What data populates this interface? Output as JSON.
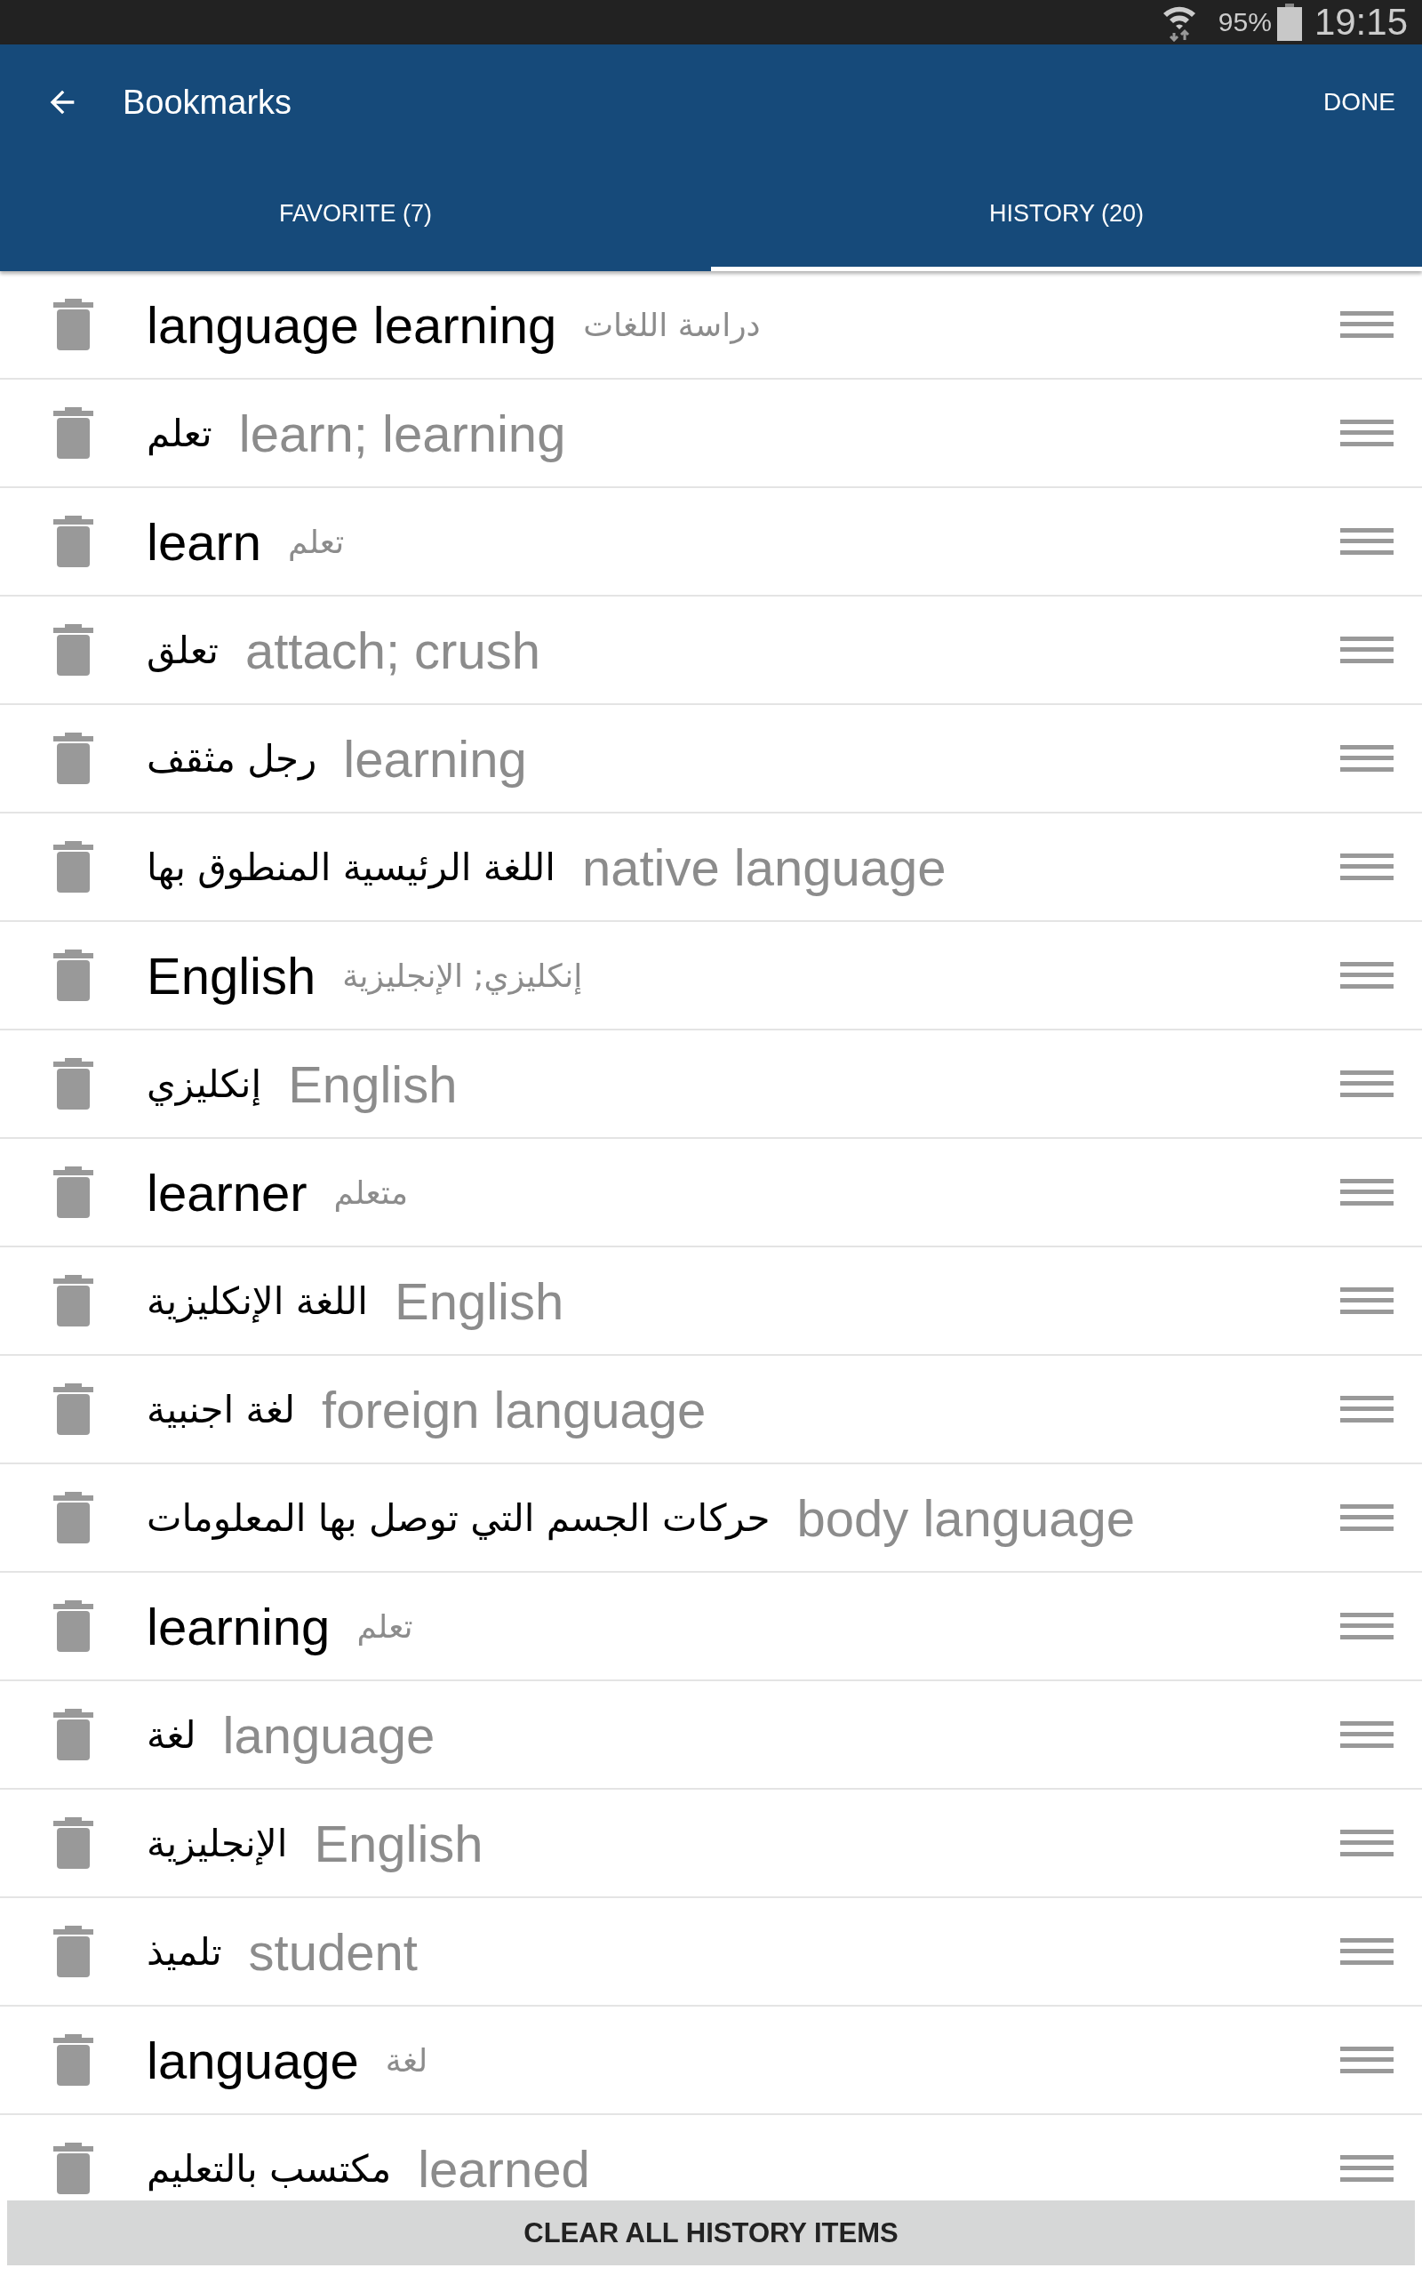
{
  "status_bar": {
    "battery": "95%",
    "time": "19:15"
  },
  "app_bar": {
    "title": "Bookmarks",
    "action": "DONE"
  },
  "tab_bar": {
    "left_tab": {
      "label": "FAVORITE (7)",
      "selected": false
    },
    "right_tab": {
      "label": "HISTORY (20)",
      "selected": true
    }
  },
  "entries": [
    {
      "kind": "en-ar",
      "headword": "language learning",
      "translation": "دراسة اللغات"
    },
    {
      "kind": "ar-en",
      "headword": "تعلم",
      "translation": "learn; learning"
    },
    {
      "kind": "en-ar",
      "headword": "learn",
      "translation": "تعلم"
    },
    {
      "kind": "ar-en",
      "headword": "تعلق",
      "translation": "attach; crush"
    },
    {
      "kind": "ar-en",
      "headword": "رجل مثقف",
      "translation": "learning"
    },
    {
      "kind": "ar-en",
      "headword": "اللغة الرئيسية المنطوق بها",
      "translation": "native language"
    },
    {
      "kind": "en-ar",
      "headword": "English",
      "translation": "إنكليزي; الإنجليزية"
    },
    {
      "kind": "ar-en",
      "headword": "إنكليزي",
      "translation": "English"
    },
    {
      "kind": "en-ar",
      "headword": "learner",
      "translation": "متعلم"
    },
    {
      "kind": "ar-en",
      "headword": "اللغة الإنكليزية",
      "translation": "English"
    },
    {
      "kind": "ar-en",
      "headword": "لغة اجنبية",
      "translation": "foreign language"
    },
    {
      "kind": "ar-en",
      "headword": "حركات الجسم التي توصل بها المعلومات",
      "translation": "body language"
    },
    {
      "kind": "en-ar",
      "headword": "learning",
      "translation": "تعلم"
    },
    {
      "kind": "ar-en",
      "headword": "لغة",
      "translation": "language"
    },
    {
      "kind": "ar-en",
      "headword": "الإنجليزية",
      "translation": "English"
    },
    {
      "kind": "ar-en",
      "headword": "تلميذ",
      "translation": "student"
    },
    {
      "kind": "en-ar",
      "headword": "language",
      "translation": "لغة"
    },
    {
      "kind": "ar-en",
      "headword": "مكتسب بالتعليم",
      "translation": "learned"
    }
  ],
  "footer_button": "CLEAR ALL HISTORY ITEMS"
}
